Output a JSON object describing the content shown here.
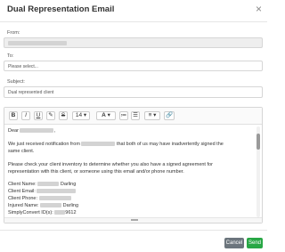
{
  "dialog": {
    "title": "Dual Representation Email",
    "close_icon": "×"
  },
  "form": {
    "from_label": "From:",
    "to_label": "To:",
    "to_placeholder": "Please select...",
    "subject_label": "Subject:",
    "subject_value": "Dual represented client"
  },
  "toolbar": {
    "bold": "B",
    "italic": "I",
    "underline": "U",
    "eraser": "✎",
    "strike": "S",
    "font_size": "14",
    "font_size_caret": "▾",
    "text_color": "A",
    "text_color_caret": "▾",
    "unordered_list": "≔",
    "ordered_list": "☰",
    "align": "≡",
    "align_caret": "▾",
    "link": "🔗"
  },
  "body": {
    "greeting": "Dear",
    "greeting_suffix": ",",
    "p1_part1": "We just received notification from",
    "p1_part2": "that both of us may have inadvertently signed the",
    "p1_line2": "same client.",
    "p2_line1": "Please check your client inventory to determine whether you also have a signed agreement for",
    "p2_line2": "representation with this client, or someone using this email and/or phone number.",
    "client_name_label": "Client Name:",
    "client_name_suffix": "Darling",
    "client_email_label": "Client Email:",
    "client_phone_label": "Client Phone:",
    "injured_name_label": "Injured Name:",
    "injured_name_suffix": "Darling",
    "simplyconvert_label": "SimplyConvert ID(s):",
    "simplyconvert_suffix": "9612"
  },
  "footer": {
    "cancel_label": "Cancel",
    "send_label": "Send"
  },
  "colors": {
    "cancel_bg": "#6c757d",
    "send_bg": "#28a745",
    "redaction": "#d3d3d3"
  }
}
